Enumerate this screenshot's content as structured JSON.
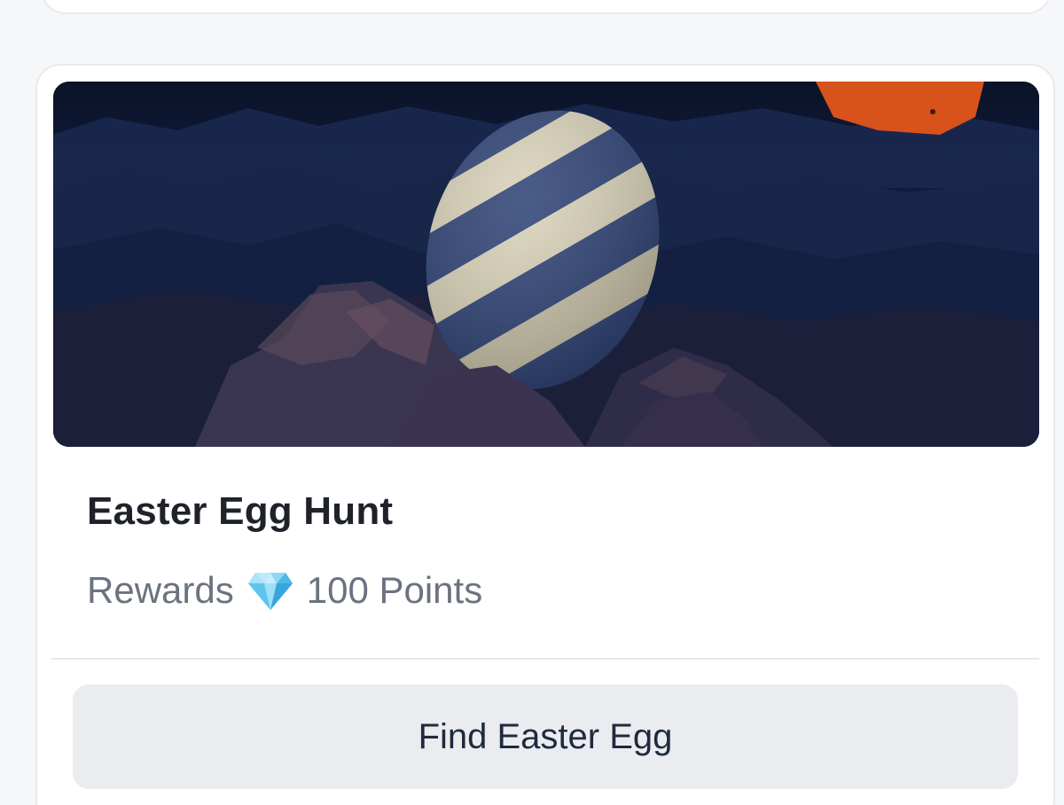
{
  "card": {
    "title": "Easter Egg Hunt",
    "rewards_label": "Rewards",
    "rewards_icon": "gem-icon",
    "rewards_value": "100 Points",
    "button_label": "Find Easter Egg"
  },
  "colors": {
    "title": "#1f2329",
    "muted_text": "#6b7280",
    "button_bg": "#ebecf0",
    "button_text": "#1f2a3d",
    "banner_sky": "#0e1830",
    "egg_stripe_light": "#d9d2b8",
    "egg_stripe_dark": "#2a3f73",
    "planet": "#e0551a"
  }
}
